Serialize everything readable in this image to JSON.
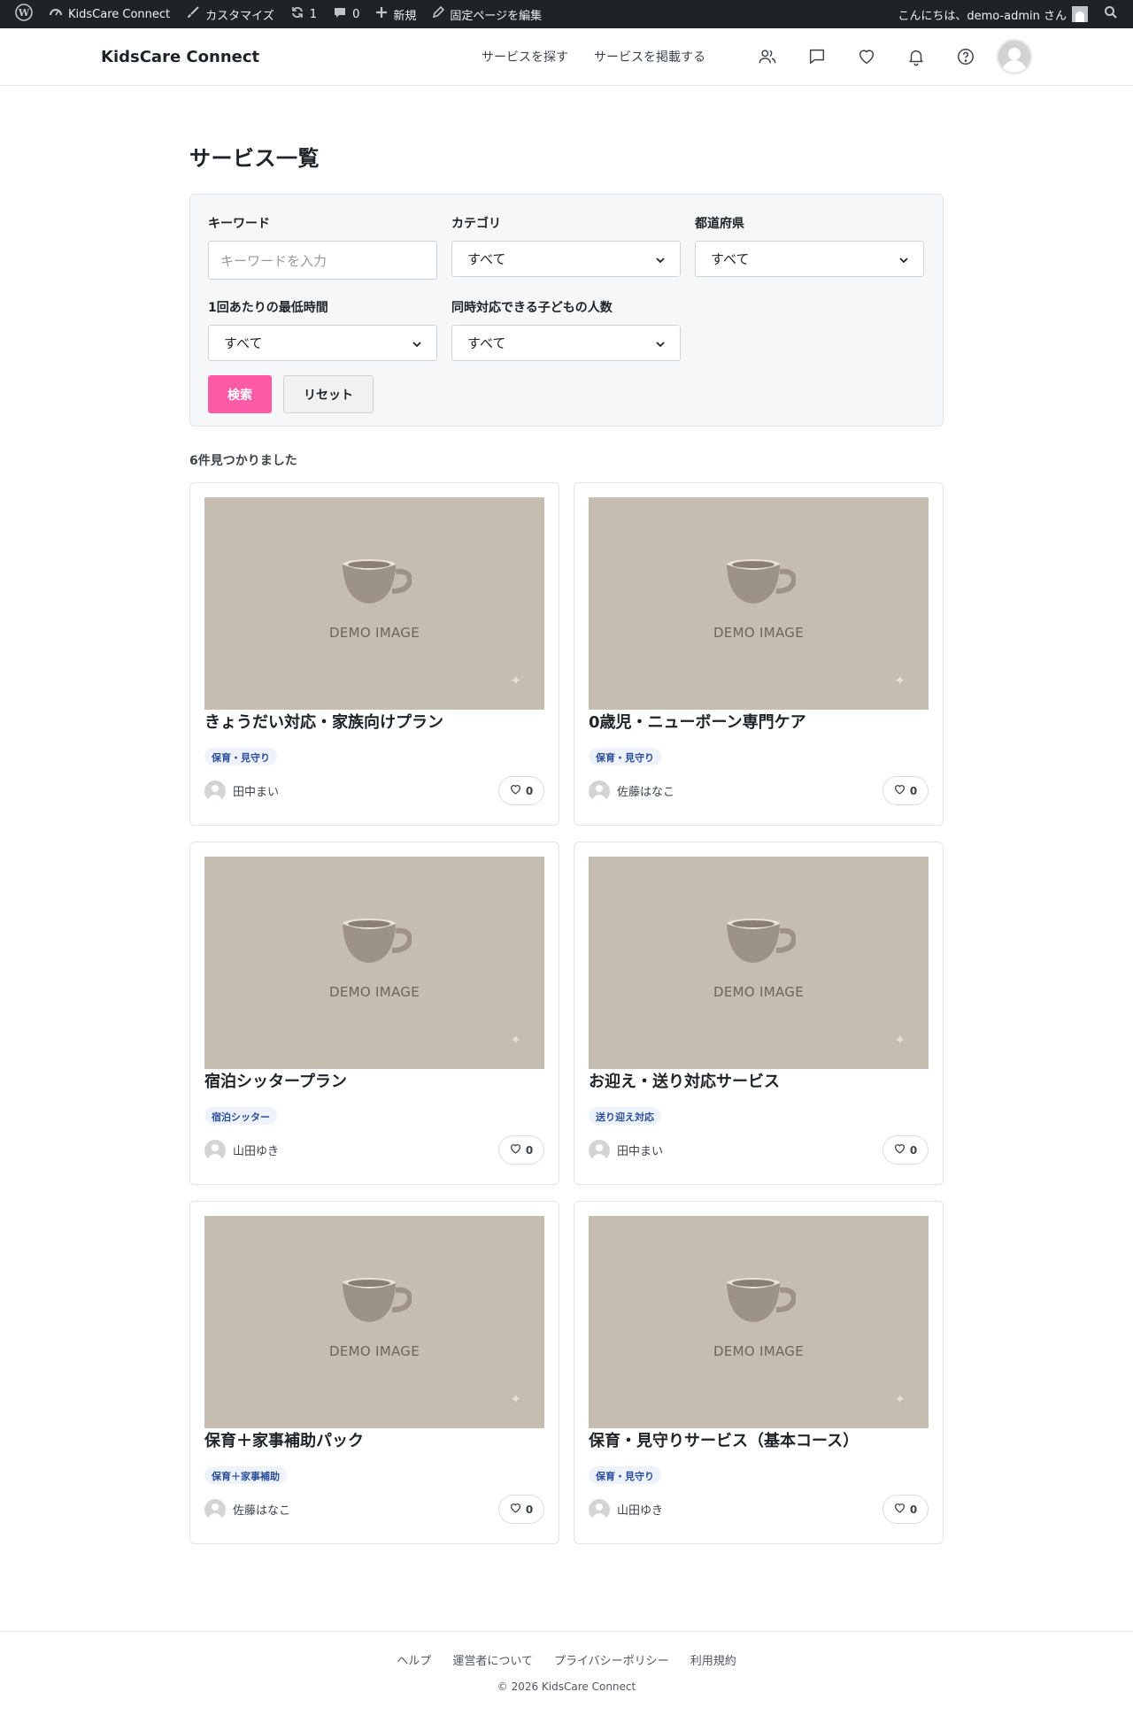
{
  "adminbar": {
    "site_name": "KidsCare Connect",
    "customize": "カスタマイズ",
    "updates_count": "1",
    "comments_count": "0",
    "new_label": "新規",
    "edit_page": "固定ページを編集",
    "greeting": "こんにちは、demo-admin さん"
  },
  "header": {
    "logo": "KidsCare Connect",
    "nav_find": "サービスを探す",
    "nav_post": "サービスを掲載する"
  },
  "page": {
    "title": "サービス一覧"
  },
  "filter": {
    "keyword_label": "キーワード",
    "keyword_placeholder": "キーワードを入力",
    "category_label": "カテゴリ",
    "category_value": "すべて",
    "prefecture_label": "都道府県",
    "prefecture_value": "すべて",
    "min_time_label": "1回あたりの最低時間",
    "min_time_value": "すべて",
    "children_label": "同時対応できる子どもの人数",
    "children_value": "すべて",
    "search_button": "検索",
    "reset_button": "リセット"
  },
  "results": {
    "count_text": "6件見つかりました"
  },
  "card_image_text": "DEMO IMAGE",
  "cards": [
    {
      "title": "きょうだい対応・家族向けプラン",
      "category": "保育・見守り",
      "author": "田中まい",
      "favorites": "0"
    },
    {
      "title": "0歳児・ニューボーン専門ケア",
      "category": "保育・見守り",
      "author": "佐藤はなこ",
      "favorites": "0"
    },
    {
      "title": "宿泊シッタープラン",
      "category": "宿泊シッター",
      "author": "山田ゆき",
      "favorites": "0"
    },
    {
      "title": "お迎え・送り対応サービス",
      "category": "送り迎え対応",
      "author": "田中まい",
      "favorites": "0"
    },
    {
      "title": "保育＋家事補助パック",
      "category": "保育＋家事補助",
      "author": "佐藤はなこ",
      "favorites": "0"
    },
    {
      "title": "保育・見守りサービス（基本コース）",
      "category": "保育・見守り",
      "author": "山田ゆき",
      "favorites": "0"
    }
  ],
  "footer": {
    "help": "ヘルプ",
    "about": "運営者について",
    "privacy": "プライバシーポリシー",
    "terms": "利用規約",
    "copyright": "© 2026 KidsCare Connect"
  },
  "colors": {
    "accent": "#ff5aa6",
    "adminbar": "#1d2327",
    "thumb": "#c5bdb0",
    "badge_text": "#2c4f9a"
  },
  "icons": [
    "wordpress-icon",
    "dashboard-icon",
    "brush-icon",
    "refresh-icon",
    "comment-icon",
    "plus-icon",
    "pencil-icon",
    "search-icon",
    "users-icon",
    "message-icon",
    "heart-icon",
    "bell-icon",
    "help-icon",
    "avatar-icon",
    "chevron-down-icon",
    "cup-icon",
    "sparkle-icon"
  ]
}
